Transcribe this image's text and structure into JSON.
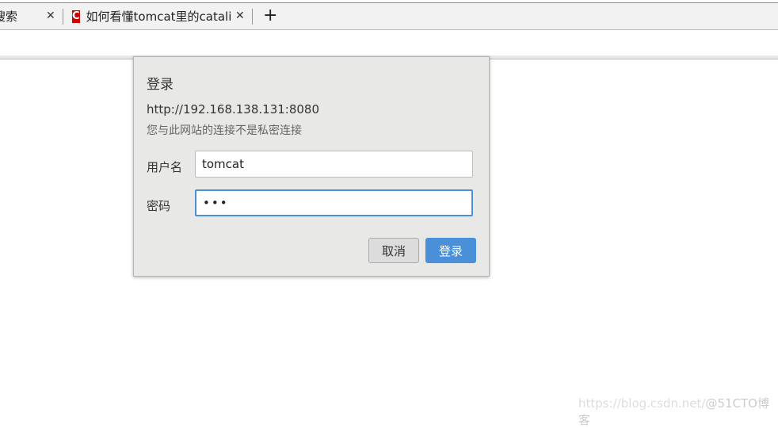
{
  "tabs": [
    {
      "label": "搜索"
    },
    {
      "label": "如何看懂tomcat里的catalin",
      "favicon": "C"
    }
  ],
  "dialog": {
    "title": "登录",
    "url": "http://192.168.138.131:8080",
    "warning": "您与此网站的连接不是私密连接",
    "username_label": "用户名",
    "username_value": "tomcat",
    "password_label": "密码",
    "password_value": "•••",
    "cancel": "取消",
    "ok": "登录"
  },
  "watermark": {
    "text": "https://blog.csdn.net/",
    "brand": "@51CTO博客"
  },
  "colors": {
    "accent": "#4a90d9",
    "favicon": "#cc0000"
  }
}
